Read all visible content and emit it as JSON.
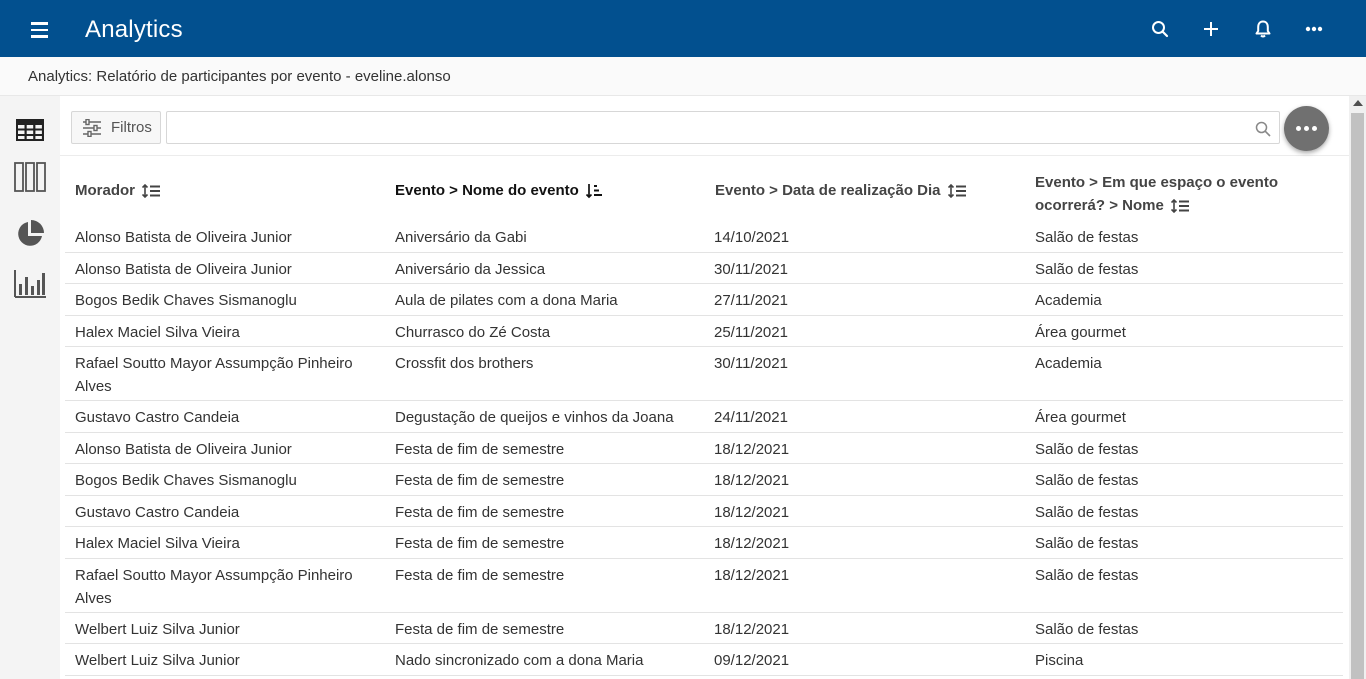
{
  "app": {
    "title": "Analytics",
    "icons": [
      "menu-icon",
      "search-icon",
      "plus-icon",
      "bell-icon",
      "more-horizontal-icon"
    ]
  },
  "breadcrumb": "Analytics: Relatório de participantes por evento - eveline.alonso",
  "sidebar": {
    "items": [
      {
        "name": "table-view-icon",
        "active": true
      },
      {
        "name": "columns-view-icon",
        "active": false
      },
      {
        "name": "pie-chart-icon",
        "active": false
      },
      {
        "name": "bar-chart-icon",
        "active": false
      }
    ]
  },
  "toolbar": {
    "filter_label": "Filtros",
    "search_value": "",
    "search_placeholder": ""
  },
  "table": {
    "columns": [
      {
        "label": "Morador"
      },
      {
        "label": "Evento > Nome do evento"
      },
      {
        "label": "Evento > Data de realização Dia"
      },
      {
        "label_line1": "Evento > Em que espaço o evento",
        "label_line2": "ocorrerá? > Nome"
      }
    ],
    "rows": [
      {
        "morador": "Alonso Batista de Oliveira Junior",
        "evento": "Aniversário da Gabi",
        "data": "14/10/2021",
        "espaco": "Salão de festas"
      },
      {
        "morador": "Alonso Batista de Oliveira Junior",
        "evento": "Aniversário da Jessica",
        "data": "30/11/2021",
        "espaco": "Salão de festas"
      },
      {
        "morador": "Bogos Bedik Chaves Sismanoglu",
        "evento": "Aula de pilates com a dona Maria",
        "data": "27/11/2021",
        "espaco": "Academia"
      },
      {
        "morador": "Halex Maciel Silva Vieira",
        "evento": "Churrasco do Zé Costa",
        "data": "25/11/2021",
        "espaco": "Área gourmet"
      },
      {
        "morador": "Rafael Soutto Mayor Assumpção Pinheiro Alves",
        "evento": "Crossfit dos brothers",
        "data": "30/11/2021",
        "espaco": "Academia"
      },
      {
        "morador": "Gustavo Castro Candeia",
        "evento": "Degustação de queijos e vinhos da Joana",
        "data": "24/11/2021",
        "espaco": "Área gourmet"
      },
      {
        "morador": "Alonso Batista de Oliveira Junior",
        "evento": "Festa de fim de semestre",
        "data": "18/12/2021",
        "espaco": "Salão de festas"
      },
      {
        "morador": "Bogos Bedik Chaves Sismanoglu",
        "evento": "Festa de fim de semestre",
        "data": "18/12/2021",
        "espaco": "Salão de festas"
      },
      {
        "morador": "Gustavo Castro Candeia",
        "evento": "Festa de fim de semestre",
        "data": "18/12/2021",
        "espaco": "Salão de festas"
      },
      {
        "morador": "Halex Maciel Silva Vieira",
        "evento": "Festa de fim de semestre",
        "data": "18/12/2021",
        "espaco": "Salão de festas"
      },
      {
        "morador": "Rafael Soutto Mayor Assumpção Pinheiro Alves",
        "evento": "Festa de fim de semestre",
        "data": "18/12/2021",
        "espaco": "Salão de festas"
      },
      {
        "morador": "Welbert Luiz Silva Junior",
        "evento": "Festa de fim de semestre",
        "data": "18/12/2021",
        "espaco": "Salão de festas"
      },
      {
        "morador": "Welbert Luiz Silva Junior",
        "evento": "Nado sincronizado com a dona Maria",
        "data": "09/12/2021",
        "espaco": "Piscina"
      }
    ]
  },
  "colors": {
    "topbar": "#02508f",
    "sidebar": "#f4f4f4",
    "fab": "#707070"
  }
}
